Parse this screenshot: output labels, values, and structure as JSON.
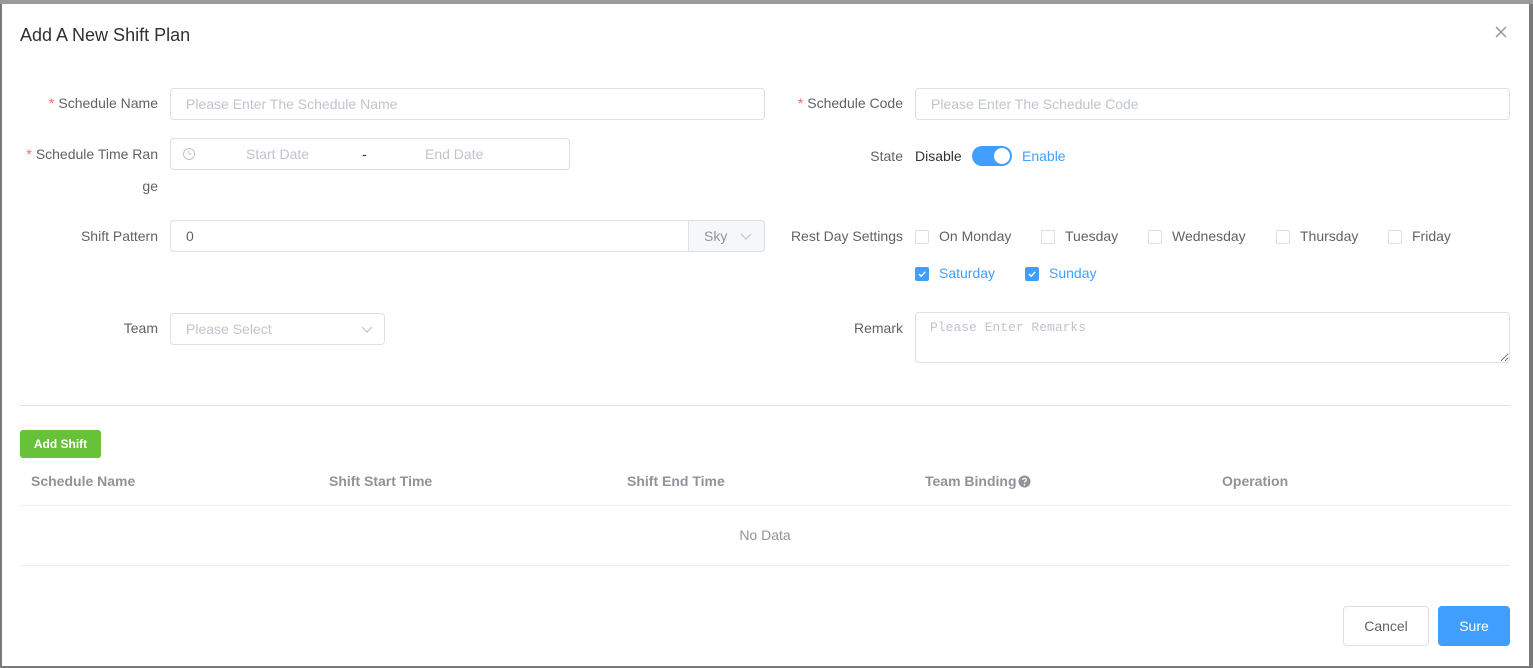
{
  "dialog": {
    "title": "Add A New Shift Plan"
  },
  "form": {
    "schedule_name": {
      "label": "Schedule Name",
      "placeholder": "Please Enter The Schedule Name"
    },
    "schedule_code": {
      "label": "Schedule Code",
      "placeholder": "Please Enter The Schedule Code"
    },
    "time_range": {
      "label_line1": "Schedule Time Ran",
      "label_line2": "ge",
      "start_placeholder": "Start Date",
      "separator": "-",
      "end_placeholder": "End Date"
    },
    "state": {
      "label": "State",
      "off_text": "Disable",
      "on_text": "Enable",
      "enabled": true
    },
    "shift_pattern": {
      "label": "Shift Pattern",
      "value": "0",
      "unit": "Sky"
    },
    "rest_days": {
      "label": "Rest Day Settings",
      "options": [
        {
          "label": "On Monday",
          "checked": false
        },
        {
          "label": "Tuesday",
          "checked": false
        },
        {
          "label": "Wednesday",
          "checked": false
        },
        {
          "label": "Thursday",
          "checked": false
        },
        {
          "label": "Friday",
          "checked": false
        },
        {
          "label": "Saturday",
          "checked": true
        },
        {
          "label": "Sunday",
          "checked": true
        }
      ]
    },
    "team": {
      "label": "Team",
      "placeholder": "Please Select"
    },
    "remark": {
      "label": "Remark",
      "placeholder": "Please Enter Remarks"
    }
  },
  "shifts": {
    "add_label": "Add Shift",
    "columns": [
      "Schedule Name",
      "Shift Start Time",
      "Shift End Time",
      "Team Binding",
      "Operation"
    ],
    "empty_text": "No Data"
  },
  "footer": {
    "cancel_label": "Cancel",
    "sure_label": "Sure"
  },
  "colors": {
    "primary": "#409eff",
    "success": "#67c23a",
    "danger": "#f56c6c"
  }
}
